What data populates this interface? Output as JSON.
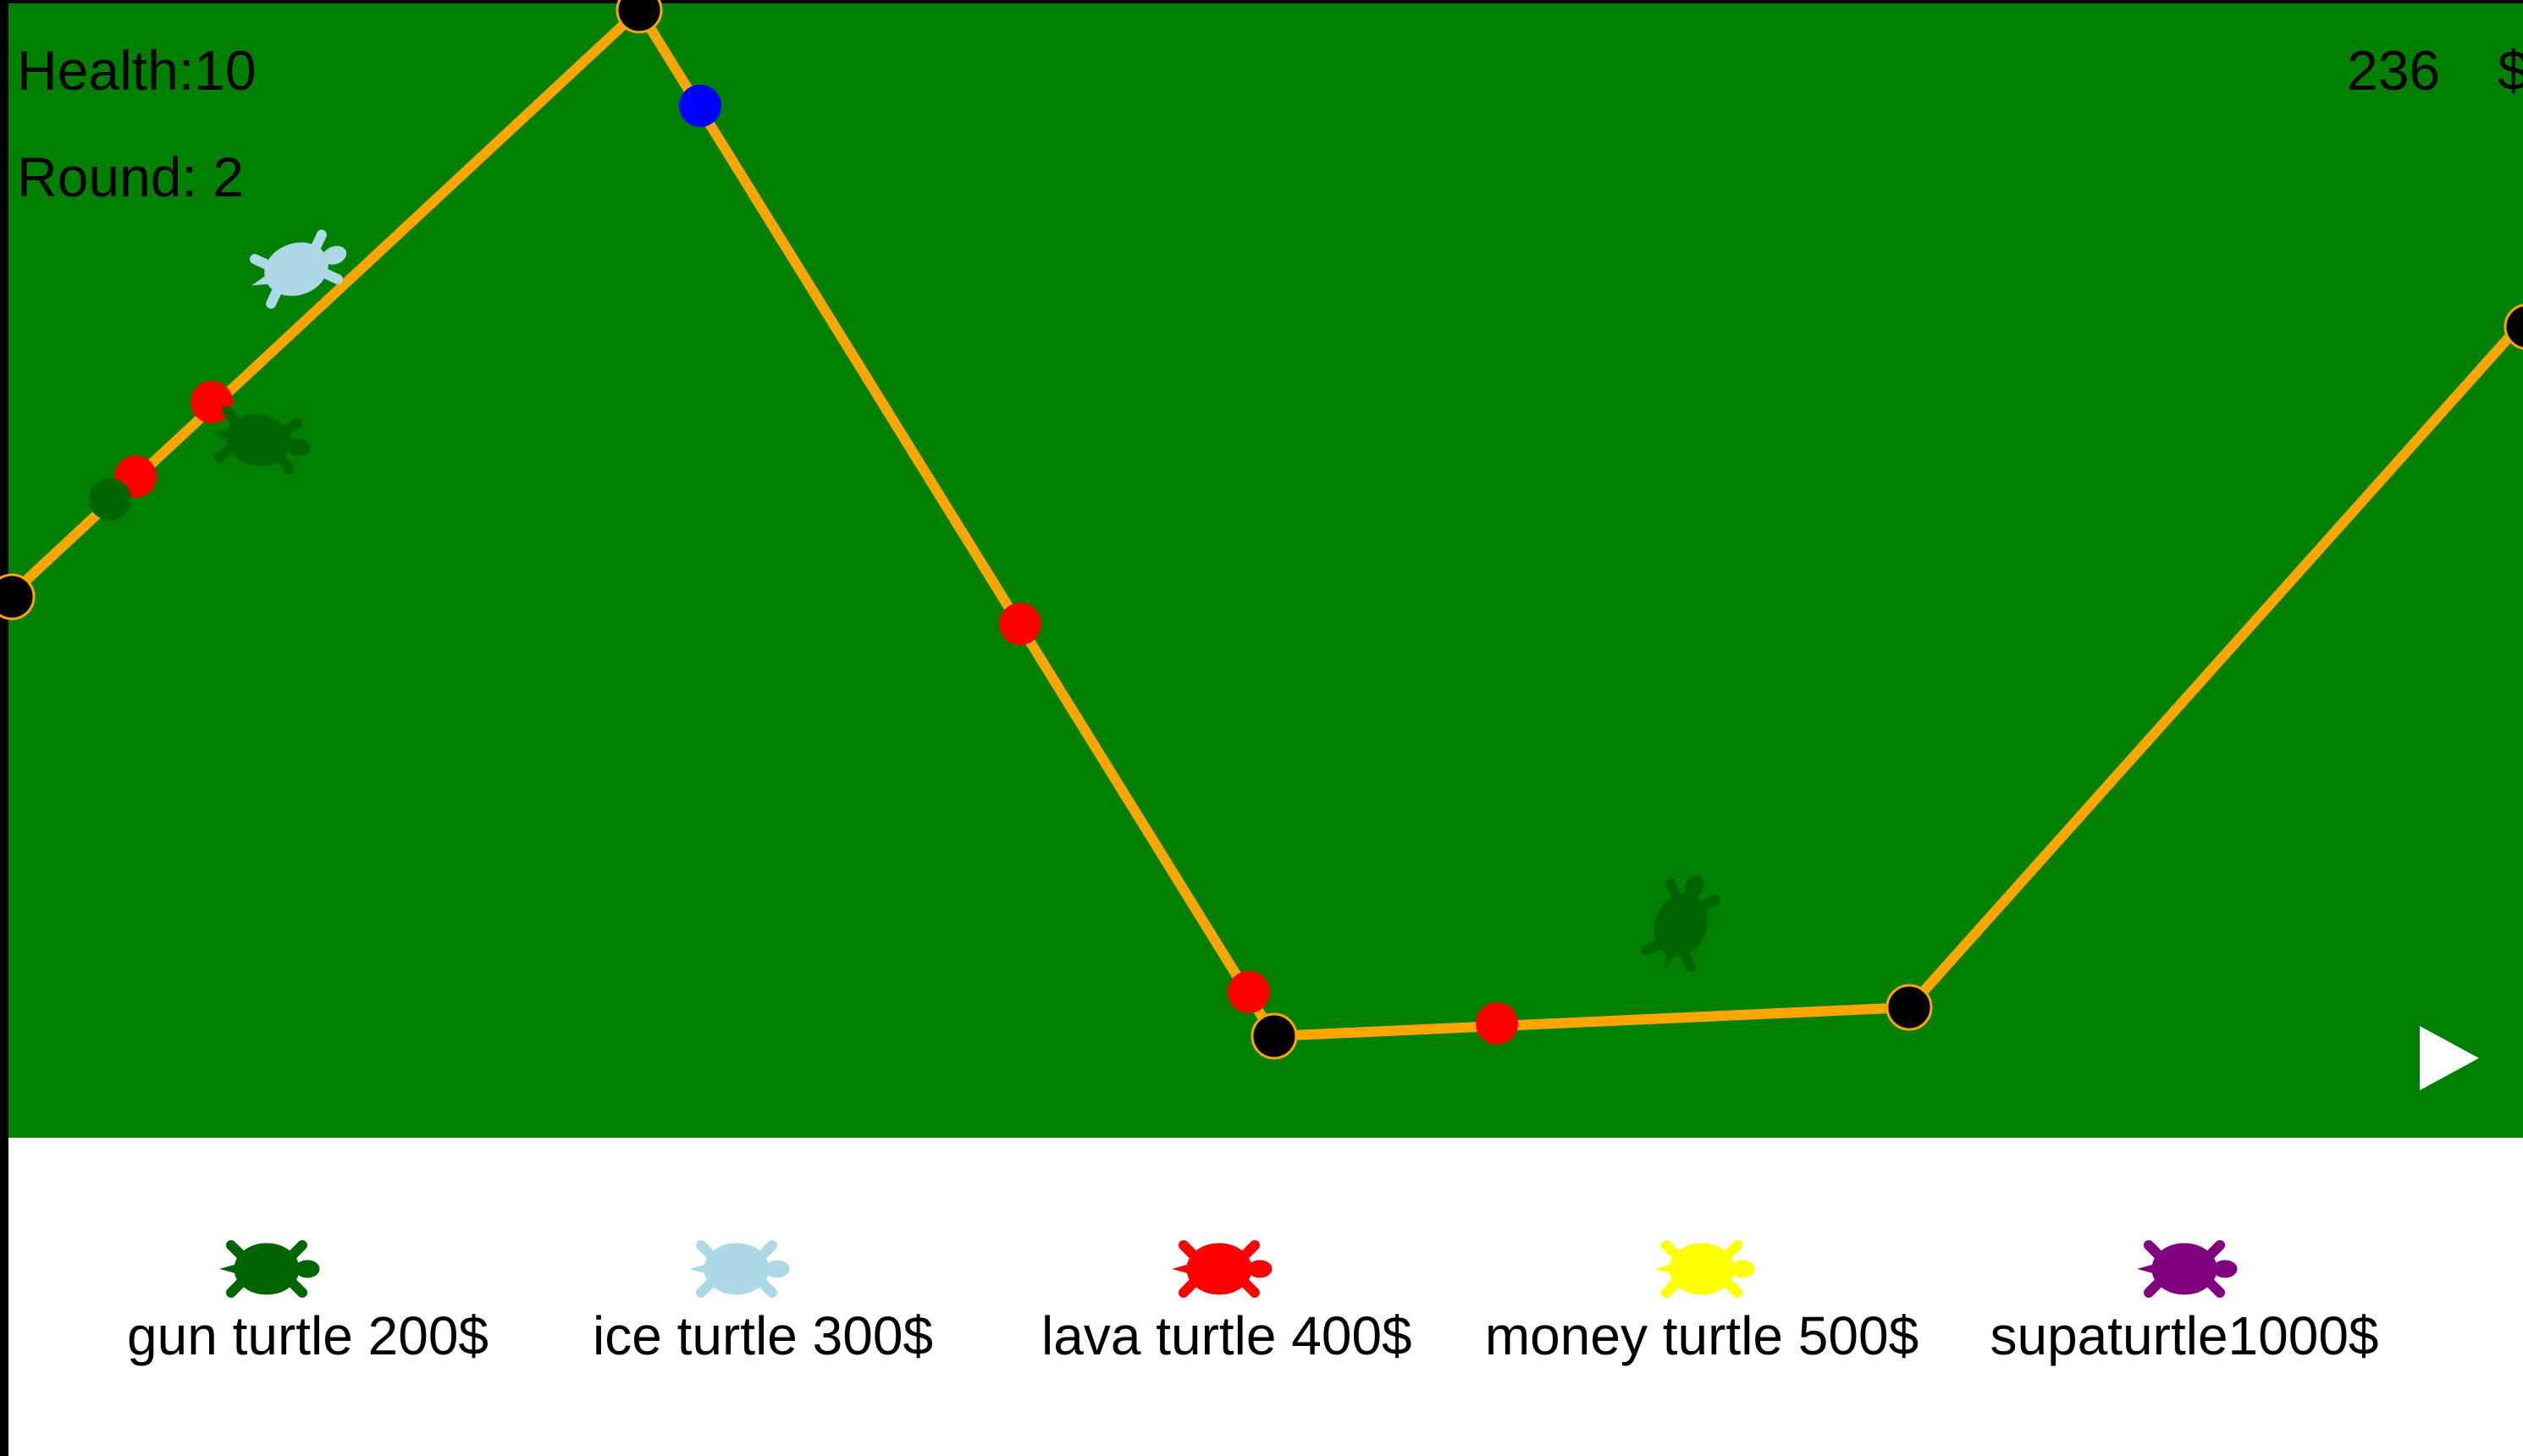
{
  "hud": {
    "health_label": "Health:",
    "health_value": "10",
    "round_label": "Round:",
    "round_value": "2",
    "money_value": "236",
    "currency": "$"
  },
  "colors": {
    "field": "#008000",
    "path": "#ffa500",
    "waypoint": "#000000",
    "enemy_red": "#ff0000",
    "enemy_blue": "#0000ff",
    "enemy_green": "#006400",
    "gun_turtle": "#006400",
    "ice_turtle": "#add8e6",
    "lava_turtle": "#ff0000",
    "money_turtle": "#ffff00",
    "supaturtle": "#800080"
  },
  "shop": {
    "items": [
      {
        "label": "gun turtle 200$",
        "icon": "gun-turtle-icon",
        "color": "#006400"
      },
      {
        "label": "ice turtle 300$",
        "icon": "ice-turtle-icon",
        "color": "#add8e6"
      },
      {
        "label": "lava turtle 400$",
        "icon": "lava-turtle-icon",
        "color": "#ff0000"
      },
      {
        "label": "money turtle 500$",
        "icon": "money-turtle-icon",
        "color": "#ffff00"
      },
      {
        "label": "supaturtle1000$",
        "icon": "supaturtle-icon",
        "color": "#800080"
      }
    ]
  },
  "controls": {
    "play_icon": "play-icon"
  }
}
